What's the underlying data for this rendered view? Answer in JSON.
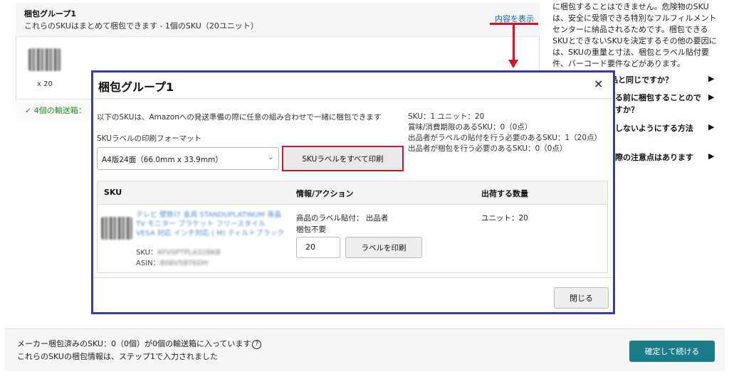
{
  "background": {
    "title": "梱包グループ1",
    "subtitle": "これらのSKUはまとめて梱包できます - 1個のSKU（20ユニット）",
    "show_link": "内容を表示",
    "qty": "x 20",
    "boxes_text": "4個の輸送箱："
  },
  "right_column": {
    "paragraph": "に梱包することはできません。危険物のSKUは、安全に受領できる特別なフルフィルメントセンターに納品されるためです。梱包できるSKUとできないSKUを決定するその他の要因には、SKUの重量と寸法、梱包とラベル貼付要件、バーコード要件などがあります。",
    "faq": [
      "商品と同じですか？",
      "る前に梱包することのですか？",
      "しないようにする方法",
      "際の注意点はあります"
    ],
    "arrow": "▶"
  },
  "modal": {
    "title": "梱包グループ1",
    "close_icon": "×",
    "description": "以下のSKUは、Amazonへの発送準備の際に任意の組み合わせで一緒に梱包できます",
    "format_label": "SKUラベルの印刷フォーマット",
    "format_value": "A4版24面（66.0mm x 33.9mm）",
    "print_all": "SKUラベルをすべて印刷",
    "stats": [
      "SKU：1  ユニット：20",
      "賞味/消費期限のあるSKU：0（0点）",
      "出品者がラベルの貼付を行う必要のあるSKU：1（20点）",
      "出品者が梱包を行う必要のあるSKU：0（0点）"
    ],
    "table": {
      "headers": [
        "SKU",
        "情報/アクション",
        "出荷する数量"
      ],
      "row": {
        "product_title": "テレビ 壁掛け 金具 STANDUPLATINUM 液晶 TV モニター ブラケット フリースタイル VESA 対応 インチ対応 ( M) ティルトブラック",
        "sku_label": "SKU：",
        "sku_value": "ATVSPTPLA32BKB",
        "asin_label": "ASIN：",
        "asin_value": "B08V5BTKDH",
        "info_line1": "商品のラベル貼付： 出品者",
        "info_line2": "梱包不要",
        "qty_value": "20",
        "print_label": "ラベルを印刷",
        "units": "ユニット：20"
      }
    },
    "close_button": "閉じる"
  },
  "bottom": {
    "line1": "メーカー梱包済みのSKU：0（0個）が0個の輸送箱に入っています",
    "help_icon": "?",
    "line2": "これらのSKUの梱包情報は、ステップ1で入力されました",
    "confirm": "確定して続ける"
  }
}
